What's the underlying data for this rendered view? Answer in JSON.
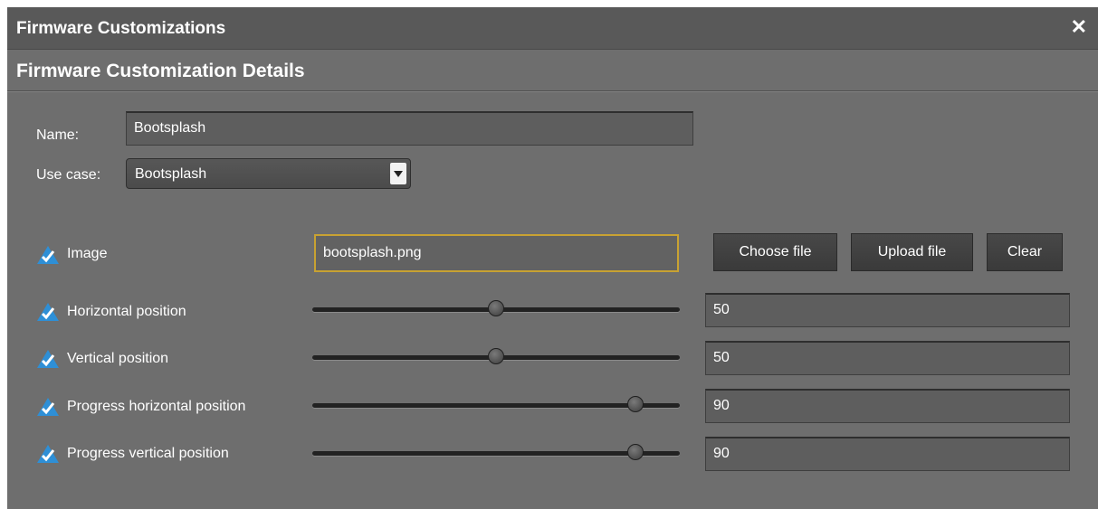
{
  "window": {
    "title": "Firmware Customizations",
    "close_icon": "close-icon"
  },
  "section": {
    "title": "Firmware Customization Details"
  },
  "form": {
    "name_label": "Name:",
    "name_value": "Bootsplash",
    "use_case_label": "Use case:",
    "use_case_value": "Bootsplash"
  },
  "image_row": {
    "label": "Image",
    "file_value": "bootsplash.png",
    "choose_label": "Choose file",
    "upload_label": "Upload file",
    "clear_label": "Clear"
  },
  "sliders": [
    {
      "label": "Horizontal position",
      "value": "50",
      "level": 50
    },
    {
      "label": "Vertical position",
      "value": "50",
      "level": 50
    },
    {
      "label": "Progress horizontal position",
      "value": "90",
      "level": 90
    },
    {
      "label": "Progress vertical position",
      "value": "90",
      "level": 90
    }
  ],
  "colors": {
    "check_blue": "#2e8fd6",
    "focus_border": "#c8a232"
  }
}
